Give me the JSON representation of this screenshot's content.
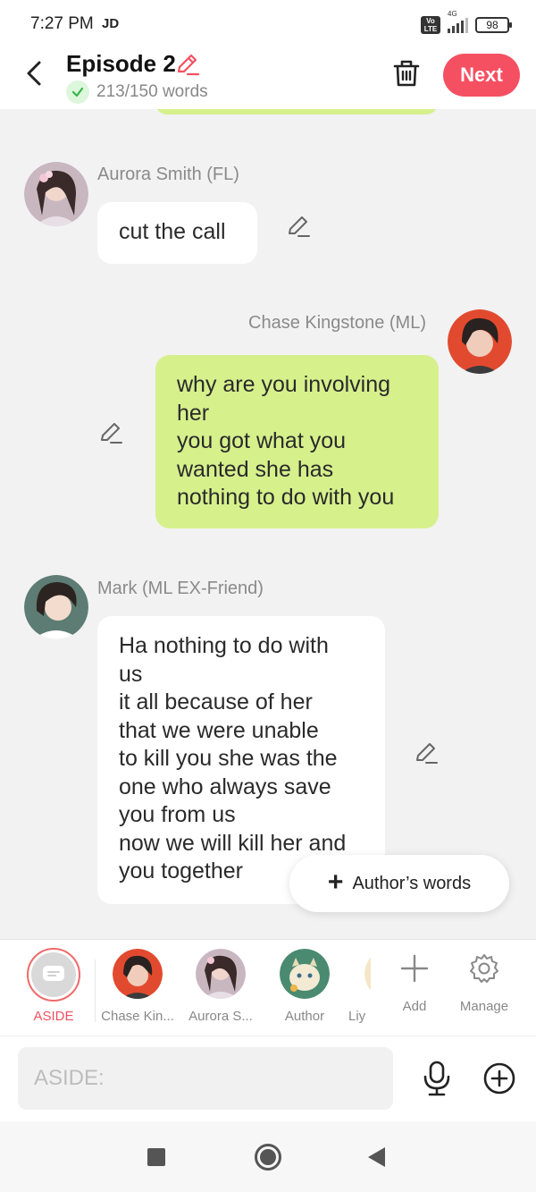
{
  "status_bar": {
    "time": "7:27 PM",
    "carrier": "JD",
    "volte_label": "Vo LTE",
    "network": "4G",
    "battery": "98"
  },
  "header": {
    "title": "Episode 2",
    "word_count": "213/150 words",
    "next_label": "Next",
    "accent_color": "#f55062"
  },
  "messages": [
    {
      "speaker": "Aurora Smith (FL)",
      "side": "left",
      "color": "white",
      "lines": [
        "cut the call"
      ]
    },
    {
      "speaker": "Chase Kingstone (ML)",
      "side": "right",
      "color": "green",
      "lines": [
        "why are you involving",
        "her",
        "you got what you",
        "wanted she has",
        "nothing to do with you"
      ]
    },
    {
      "speaker": "Mark (ML EX-Friend)",
      "side": "left",
      "color": "white",
      "lines": [
        "Ha nothing to do with",
        "us",
        "it all because of her",
        "that we were unable",
        "to kill you she was the",
        "one who always save",
        "you from us",
        "now we will kill her and",
        "you together"
      ]
    }
  ],
  "authors_words_label": "Author’s words",
  "characters": [
    {
      "label": "ASIDE",
      "icon": "aside-icon"
    },
    {
      "label": "Chase Kin...",
      "icon": "avatar"
    },
    {
      "label": "Aurora S...",
      "icon": "avatar"
    },
    {
      "label": "Author",
      "icon": "avatar"
    },
    {
      "label": "Liy",
      "icon": "avatar"
    }
  ],
  "tools": {
    "add_label": "Add",
    "manage_label": "Manage"
  },
  "input": {
    "placeholder": "ASIDE:",
    "value": ""
  },
  "colors": {
    "green_bubble": "#d6f08c",
    "background": "#f2f2f2"
  }
}
